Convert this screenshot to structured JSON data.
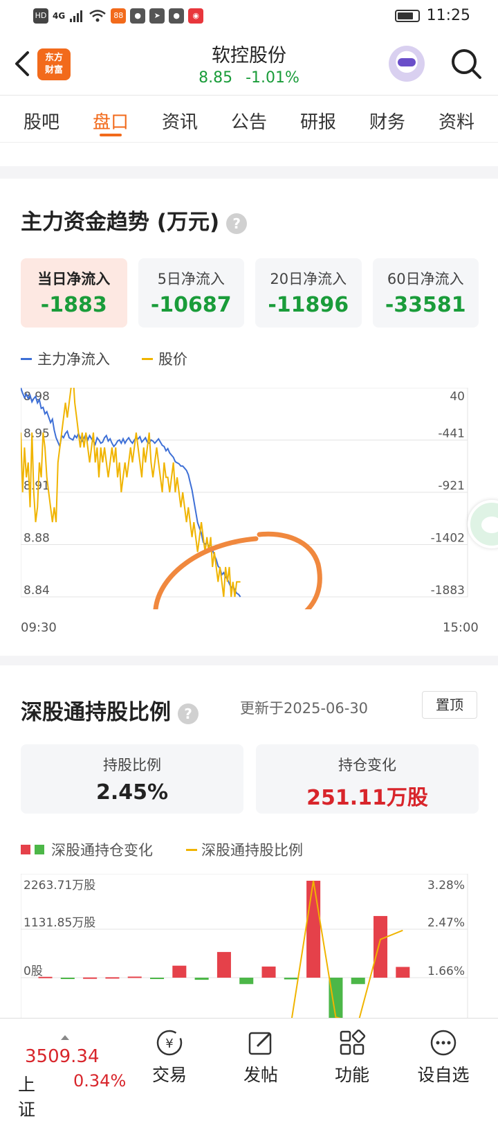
{
  "status_bar": {
    "time": "11:25",
    "network": "4G",
    "icons": [
      "hd-icon",
      "signal-icon",
      "wifi-icon",
      "app-icon",
      "wechat-icon",
      "send-icon",
      "wechat-icon",
      "weibo-icon"
    ]
  },
  "header": {
    "title": "软控股份",
    "price": "8.85",
    "change": "-1.01%",
    "logo_text": "东方财富"
  },
  "tabs": [
    "股吧",
    "盘口",
    "资讯",
    "公告",
    "研报",
    "财务",
    "资料"
  ],
  "active_tab": "盘口",
  "main_fund": {
    "title": "主力资金趋势 (万元)",
    "cards": [
      {
        "label": "当日净流入",
        "value": "-1883"
      },
      {
        "label": "5日净流入",
        "value": "-10687"
      },
      {
        "label": "20日净流入",
        "value": "-11896"
      },
      {
        "label": "60日净流入",
        "value": "-33581"
      }
    ],
    "legend": [
      "主力净流入",
      "股价"
    ],
    "colors": {
      "inflow": "#3d6fd6",
      "price": "#f0b400",
      "annotation": "#f0883e"
    },
    "time_start": "09:30",
    "time_end": "15:00"
  },
  "chart_data": [
    {
      "type": "line",
      "title": "主力资金趋势 (万元)",
      "x_start": "09:30",
      "x_end": "15:00",
      "left_axis_ticks": [
        "8.98",
        "8.95",
        "8.91",
        "8.88",
        "8.84"
      ],
      "right_axis_ticks": [
        "40",
        "-441",
        "-921",
        "-1402",
        "-1883"
      ],
      "ylim_price": [
        8.84,
        8.98
      ],
      "ylim_flow": [
        -1883,
        40
      ],
      "x_range_minutes": [
        0,
        240
      ],
      "series": [
        {
          "name": "主力净流入",
          "axis": "right",
          "x": [
            0,
            1,
            2,
            3,
            4,
            5,
            6,
            7,
            8,
            9,
            10,
            11,
            12,
            13,
            14,
            15,
            16,
            17,
            18,
            19,
            20,
            21,
            22,
            23,
            24,
            25,
            26,
            27,
            28,
            29,
            30,
            31,
            32,
            33,
            34,
            35,
            36,
            37,
            38,
            39,
            40,
            41,
            42,
            43,
            44,
            45,
            46,
            47,
            48,
            49,
            50,
            51,
            52,
            53,
            54,
            55,
            56,
            57,
            58,
            59,
            60,
            61,
            62,
            63,
            64,
            65,
            66,
            67,
            68,
            69,
            70,
            71,
            72,
            73,
            74,
            75,
            76,
            77,
            78,
            79,
            80,
            81,
            82,
            83,
            84,
            85,
            86,
            87,
            88,
            89,
            90,
            91,
            92,
            93,
            94,
            95,
            96,
            97,
            98,
            99,
            100,
            101,
            102,
            103,
            104,
            105,
            106,
            107,
            108,
            109,
            110,
            111,
            112,
            113,
            114,
            115,
            116,
            117,
            118
          ],
          "values": [
            40,
            -10,
            -50,
            -20,
            -60,
            -30,
            -90,
            -60,
            -40,
            -100,
            -70,
            -150,
            -140,
            -200,
            -180,
            -230,
            -280,
            -250,
            -350,
            -420,
            -460,
            -500,
            -400,
            -420,
            -380,
            -360,
            -420,
            -430,
            -440,
            -400,
            -420,
            -380,
            -420,
            -450,
            -420,
            -390,
            -440,
            -400,
            -430,
            -450,
            -480,
            -420,
            -440,
            -470,
            -460,
            -420,
            -400,
            -450,
            -430,
            -470,
            -500,
            -480,
            -450,
            -440,
            -470,
            -430,
            -470,
            -440,
            -420,
            -450,
            -470,
            -440,
            -420,
            -430,
            -410,
            -460,
            -440,
            -420,
            -460,
            -470,
            -440,
            -450,
            -470,
            -450,
            -430,
            -460,
            -490,
            -500,
            -540,
            -520,
            -560,
            -580,
            -600,
            -640,
            -650,
            -660,
            -680,
            -680,
            -700,
            -720,
            -760,
            -830,
            -900,
            -1000,
            -1100,
            -1200,
            -1250,
            -1300,
            -1380,
            -1400,
            -1380,
            -1420,
            -1400,
            -1450,
            -1500,
            -1540,
            -1600,
            -1620,
            -1680,
            -1660,
            -1700,
            -1720,
            -1760,
            -1800,
            -1780,
            -1820,
            -1850,
            -1860,
            -1883
          ]
        },
        {
          "name": "股价",
          "axis": "left",
          "x": [
            0,
            1,
            2,
            3,
            4,
            5,
            6,
            7,
            8,
            9,
            10,
            11,
            12,
            13,
            14,
            15,
            16,
            17,
            18,
            19,
            20,
            21,
            22,
            23,
            24,
            25,
            26,
            27,
            28,
            29,
            30,
            31,
            32,
            33,
            34,
            35,
            36,
            37,
            38,
            39,
            40,
            41,
            42,
            43,
            44,
            45,
            46,
            47,
            48,
            49,
            50,
            51,
            52,
            53,
            54,
            55,
            56,
            57,
            58,
            59,
            60,
            61,
            62,
            63,
            64,
            65,
            66,
            67,
            68,
            69,
            70,
            71,
            72,
            73,
            74,
            75,
            76,
            77,
            78,
            79,
            80,
            81,
            82,
            83,
            84,
            85,
            86,
            87,
            88,
            89,
            90,
            91,
            92,
            93,
            94,
            95,
            96,
            97,
            98,
            99,
            100,
            101,
            102,
            103,
            104,
            105,
            106,
            107,
            108,
            109,
            110,
            111,
            112,
            113,
            114,
            115,
            116,
            117,
            118
          ],
          "values": [
            8.95,
            8.91,
            8.94,
            8.92,
            8.93,
            8.9,
            8.95,
            8.91,
            8.89,
            8.9,
            8.93,
            8.92,
            8.95,
            8.94,
            8.92,
            8.91,
            8.9,
            8.89,
            8.9,
            8.89,
            8.93,
            8.94,
            8.95,
            8.96,
            8.97,
            8.96,
            8.97,
            8.98,
            8.99,
            8.97,
            8.96,
            8.95,
            8.94,
            8.95,
            8.94,
            8.95,
            8.94,
            8.93,
            8.94,
            8.95,
            8.93,
            8.94,
            8.92,
            8.94,
            8.93,
            8.94,
            8.93,
            8.92,
            8.93,
            8.94,
            8.93,
            8.94,
            8.92,
            8.93,
            8.91,
            8.92,
            8.93,
            8.92,
            8.93,
            8.94,
            8.93,
            8.94,
            8.95,
            8.94,
            8.93,
            8.92,
            8.94,
            8.93,
            8.94,
            8.95,
            8.93,
            8.92,
            8.93,
            8.94,
            8.93,
            8.92,
            8.91,
            8.93,
            8.92,
            8.92,
            8.91,
            8.92,
            8.93,
            8.91,
            8.92,
            8.91,
            8.9,
            8.91,
            8.9,
            8.89,
            8.9,
            8.89,
            8.88,
            8.89,
            8.88,
            8.87,
            8.88,
            8.89,
            8.88,
            8.87,
            8.88,
            8.87,
            8.88,
            8.86,
            8.87,
            8.86,
            8.85,
            8.86,
            8.85,
            8.84,
            8.86,
            8.85,
            8.86,
            8.84,
            8.85,
            8.84,
            8.85,
            8.85,
            8.85
          ]
        }
      ]
    },
    {
      "type": "bar",
      "title": "深股通持股比例",
      "left_axis_ticks": [
        "2263.71万股",
        "1131.85万股",
        "0股"
      ],
      "right_axis_ticks": [
        "3.28%",
        "2.47%",
        "1.66%"
      ],
      "ylim_shares_wan": [
        -1131.85,
        2263.71
      ],
      "ylim_ratio": [
        0.85,
        3.28
      ],
      "series": [
        {
          "name": "深股通持仓变化",
          "unit": "万股",
          "values": [
            20,
            -30,
            5,
            10,
            25,
            -20,
            280,
            -50,
            600,
            -150,
            260,
            -40,
            2263.71,
            -1000,
            -150,
            1440,
            251.11
          ]
        },
        {
          "name": "深股通持股比例",
          "unit": "%",
          "values": [
            null,
            null,
            null,
            null,
            null,
            null,
            null,
            null,
            null,
            null,
            null,
            0.9,
            3.28,
            1.0,
            0.9,
            2.3,
            2.45
          ]
        }
      ]
    }
  ],
  "hold": {
    "title": "深股通持股比例",
    "updated": "更新于2025-06-30",
    "pin": "置顶",
    "cards": [
      {
        "label": "持股比例",
        "value": "2.45%"
      },
      {
        "label": "持仓变化",
        "value": "251.11万股"
      }
    ],
    "legend": [
      "深股通持仓变化",
      "深股通持股比例"
    ],
    "colors": {
      "up": "#e5414a",
      "down": "#4cb748",
      "ratio": "#f0b400"
    }
  },
  "bottom": {
    "index_value": "3509.34",
    "index_name": "上证",
    "index_pct": "0.34%",
    "buttons": [
      "交易",
      "发帖",
      "功能",
      "设自选"
    ]
  }
}
